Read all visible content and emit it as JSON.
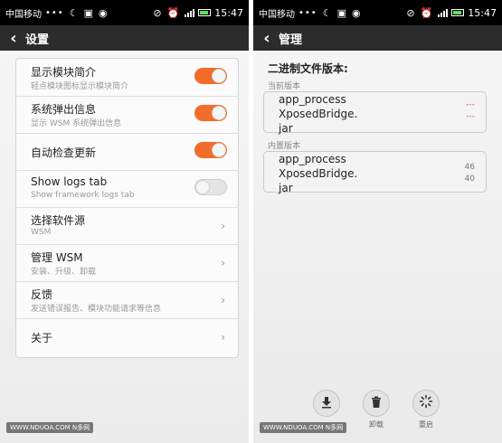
{
  "status_bar": {
    "carrier": "中国移动",
    "dots": "•••",
    "time": "15:47"
  },
  "left_screen": {
    "title": "设置",
    "rows": [
      {
        "label": "显示模块简介",
        "sublabel": "轻点模块图标显示模块简介",
        "toggle": true
      },
      {
        "label": "系统弹出信息",
        "sublabel": "显示 WSM 系统弹出信息",
        "toggle": true
      },
      {
        "label": "自动检查更新",
        "toggle": true
      },
      {
        "label": "Show logs tab",
        "sublabel": "Show framework logs tab",
        "toggle": false
      },
      {
        "label": "选择软件源",
        "sublabel": "WSM"
      },
      {
        "label": "管理 WSM",
        "sublabel": "安装、升级、卸载"
      },
      {
        "label": "反馈",
        "sublabel": "发送错误报告、模块功能请求等信息"
      },
      {
        "label": "关于"
      }
    ]
  },
  "right_screen": {
    "title": "管理",
    "heading": "二进制文件版本:",
    "current": {
      "label": "当前版本",
      "name_line1": "app_process",
      "name_line2": "XposedBridge.",
      "name_line3": "jar",
      "value1": "---",
      "value2": "---"
    },
    "builtin": {
      "label": "内置版本",
      "name_line1": "app_process",
      "name_line2": "XposedBridge.",
      "name_line3": "jar",
      "value1": "46",
      "value2": "40"
    },
    "buttons": {
      "uninstall": "卸载",
      "reboot": "重启"
    }
  },
  "watermark": "WWW.NDUOA.COM N多网",
  "colors": {
    "accent": "#f26c2a",
    "missing_value": "#e05050",
    "titlebar": "#2c2c2c"
  }
}
